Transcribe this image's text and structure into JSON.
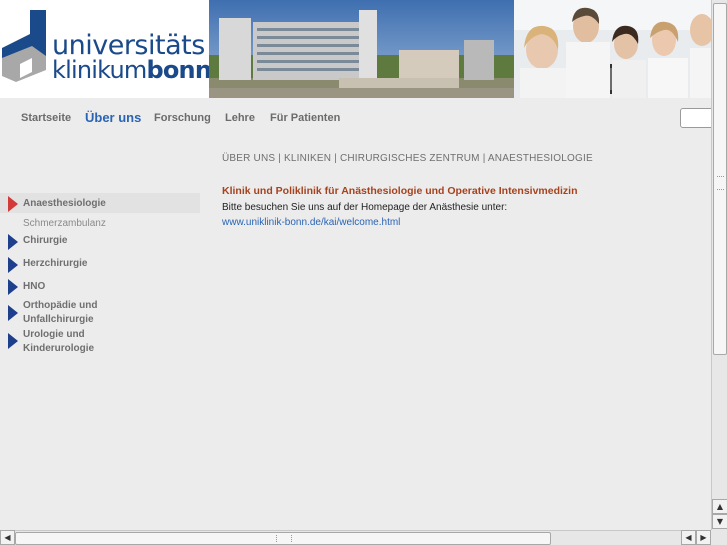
{
  "logo": {
    "line1": "universitäts",
    "line2_light": "klinikum",
    "line2_bold": "bonn",
    "colors": {
      "blue": "#1a4a8a",
      "gray": "#9b9b9b"
    }
  },
  "topnav": {
    "items": [
      {
        "label": "Startseite",
        "active": false
      },
      {
        "label": "Über uns",
        "active": true
      },
      {
        "label": "Forschung",
        "active": false
      },
      {
        "label": "Lehre",
        "active": false
      },
      {
        "label": "Für Patienten",
        "active": false
      }
    ],
    "active_color": "#2a64b4"
  },
  "search": {
    "value": ""
  },
  "breadcrumb": "ÜBER UNS | KLINIKEN | CHIRURGISCHES ZENTRUM | ANAESTHESIOLOGIE",
  "sidebar": {
    "items": [
      {
        "label": "Anaesthesiologie",
        "arrow": "red-arrow-icon"
      },
      {
        "label": "Schmerzambulanz",
        "arrow": ""
      },
      {
        "label": "Chirurgie",
        "arrow": "blue-arrow-icon"
      },
      {
        "label": "Herzchirurgie",
        "arrow": "blue-arrow-icon"
      },
      {
        "label": "HNO",
        "arrow": "blue-arrow-icon"
      },
      {
        "label": "Orthopädie und",
        "label2": "Unfallchirurgie",
        "arrow": "blue-arrow-icon"
      },
      {
        "label": "Urologie und",
        "label2": "Kinderurologie",
        "arrow": "blue-arrow-icon"
      }
    ]
  },
  "content": {
    "heading": "Klinik und Poliklinik für Anästhesiologie und Operative Intensivmedizin",
    "text": "Bitte besuchen Sie uns auf der Homepage der Anästhesie unter:",
    "link": "www.uniklinik-bonn.de/kai/welcome.html",
    "heading_color": "#a6421d"
  }
}
